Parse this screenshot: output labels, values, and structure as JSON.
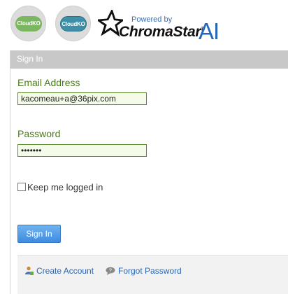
{
  "logos": {
    "cloudko_1": "CloudKO",
    "cloudko_2": "CloudKO",
    "powered_by": "Powered by",
    "chroma_word": "ChromaStar",
    "ai": "AI"
  },
  "panel": {
    "header": "Sign In",
    "email_label": "Email Address",
    "email_value": "kacomeau+a@36pix.com",
    "password_label": "Password",
    "password_value": "•••••••",
    "remember_label": "Keep me logged in",
    "signin_button": "Sign In"
  },
  "footer": {
    "create_account": "Create Account",
    "forgot_password": "Forgot Password"
  }
}
